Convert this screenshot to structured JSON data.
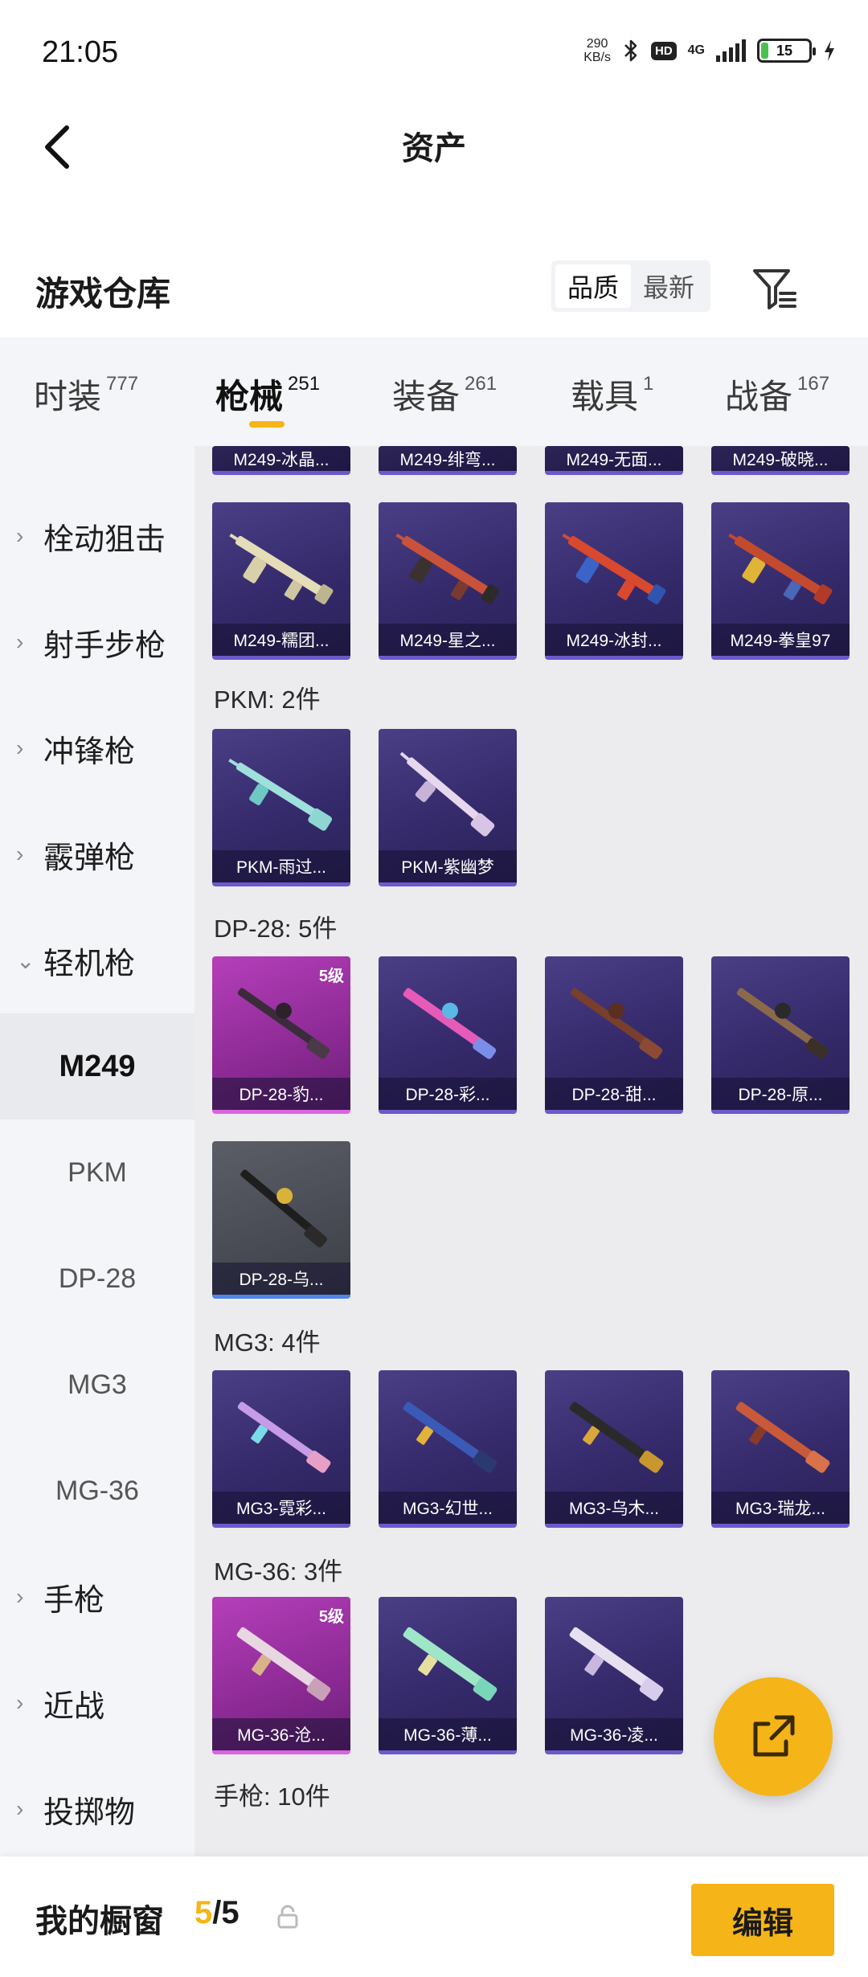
{
  "status_bar": {
    "time": "21:05",
    "net_speed_value": "290",
    "net_speed_unit": "KB/s",
    "hd": "HD",
    "network": "4G",
    "battery": "15",
    "battery_level": 0.15,
    "icons": [
      "bluetooth-icon",
      "signal-icon",
      "battery-icon",
      "charging-icon"
    ]
  },
  "header": {
    "title": "资产",
    "back_icon": "chevron-left-icon"
  },
  "section": {
    "title": "游戏仓库",
    "sort_options": [
      "品质",
      "最新"
    ],
    "sort_selected": "品质",
    "filter_icon": "filter-icon"
  },
  "tabs": [
    {
      "label": "时装",
      "count": "777"
    },
    {
      "label": "枪械",
      "count": "251",
      "active": true
    },
    {
      "label": "装备",
      "count": "261"
    },
    {
      "label": "载具",
      "count": "1"
    },
    {
      "label": "战备",
      "count": "167"
    }
  ],
  "sidebar": {
    "categories": [
      "栓动狙击",
      "射手步枪",
      "冲锋枪",
      "霰弹枪",
      "轻机枪"
    ],
    "expanded": "轻机枪",
    "subitems": [
      "M249",
      "PKM",
      "DP-28",
      "MG3",
      "MG-36"
    ],
    "active_sub": "M249",
    "bottom_categories": [
      "手枪",
      "近战",
      "投掷物"
    ]
  },
  "content": {
    "m249_top_partial": [
      "M249-冰晶...",
      "M249-绯弯...",
      "M249-无面...",
      "M249-破晓..."
    ],
    "m249_row": [
      "M249-糯团...",
      "M249-星之...",
      "M249-冰封...",
      "M249-拳皇97"
    ],
    "groups": [
      {
        "title": "PKM: 2件",
        "items": [
          "PKM-雨过...",
          "PKM-紫幽梦"
        ]
      },
      {
        "title": "DP-28: 5件",
        "items": [
          "DP-28-豹...",
          "DP-28-彩...",
          "DP-28-甜...",
          "DP-28-原...",
          "DP-28-乌..."
        ]
      },
      {
        "title": "MG3: 4件",
        "items": [
          "MG3-霓彩...",
          "MG3-幻世...",
          "MG3-乌木...",
          "MG3-瑞龙..."
        ]
      },
      {
        "title": "MG-36: 3件",
        "items": [
          "MG-36-沧...",
          "MG-36-薄...",
          "MG-36-凌..."
        ]
      },
      {
        "title": "手枪: 10件",
        "items": []
      }
    ],
    "level_badge": "5级"
  },
  "fab": {
    "icon": "share-icon"
  },
  "bottom_bar": {
    "label": "我的橱窗",
    "count_current": "5",
    "count_total": "/5",
    "lock_icon": "lock-icon",
    "edit_label": "编辑"
  },
  "colors": {
    "accent": "#f5b418",
    "card_purple": "#3a2f72",
    "card_pink": "#a436ad",
    "card_gray": "#50535b"
  }
}
